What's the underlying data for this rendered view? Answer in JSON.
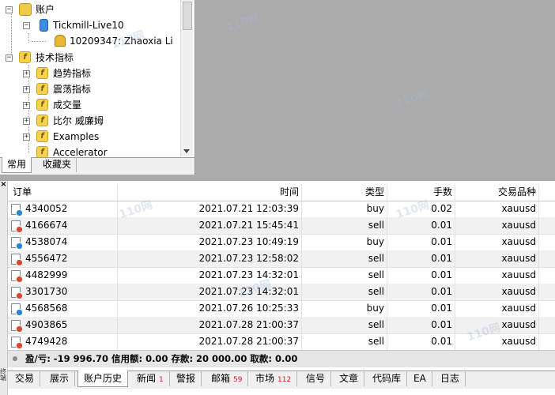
{
  "navigator": {
    "accounts_label": "账户",
    "server_label": "Tickmill-Live10",
    "account_label": "10209347: Zhaoxia Li",
    "indicators_label": "技术指标",
    "indicator_groups": [
      {
        "label": "趋势指标"
      },
      {
        "label": "震荡指标"
      },
      {
        "label": "成交量"
      },
      {
        "label": "比尔 威廉姆"
      },
      {
        "label": "Examples"
      },
      {
        "label": "Accelerator"
      }
    ],
    "tabs": [
      {
        "label": "常用"
      },
      {
        "label": "收藏夹"
      }
    ]
  },
  "terminal": {
    "close_glyph": "×",
    "side_label": "终端",
    "columns": {
      "order": "订单",
      "time": "时间",
      "type": "类型",
      "volume": "手数",
      "symbol": "交易品种"
    },
    "rows": [
      {
        "order": "4340052",
        "time": "2021.07.21 12:03:39",
        "type": "buy",
        "volume": "0.02",
        "symbol": "xauusd"
      },
      {
        "order": "4166674",
        "time": "2021.07.21 15:45:41",
        "type": "sell",
        "volume": "0.01",
        "symbol": "xauusd"
      },
      {
        "order": "4538074",
        "time": "2021.07.23 10:49:19",
        "type": "buy",
        "volume": "0.01",
        "symbol": "xauusd"
      },
      {
        "order": "4556472",
        "time": "2021.07.23 12:58:02",
        "type": "sell",
        "volume": "0.01",
        "symbol": "xauusd"
      },
      {
        "order": "4482999",
        "time": "2021.07.23 14:32:01",
        "type": "sell",
        "volume": "0.01",
        "symbol": "xauusd"
      },
      {
        "order": "3301730",
        "time": "2021.07.23 14:32:01",
        "type": "sell",
        "volume": "0.01",
        "symbol": "xauusd"
      },
      {
        "order": "4568568",
        "time": "2021.07.26 10:25:33",
        "type": "buy",
        "volume": "0.01",
        "symbol": "xauusd"
      },
      {
        "order": "4903865",
        "time": "2021.07.28 21:00:37",
        "type": "sell",
        "volume": "0.01",
        "symbol": "xauusd"
      },
      {
        "order": "4749428",
        "time": "2021.07.28 21:00:37",
        "type": "sell",
        "volume": "0.01",
        "symbol": "xauusd"
      }
    ],
    "summary": "盈/亏: -19 996.70  信用额: 0.00  存款: 20 000.00  取款: 0.00",
    "tabs": [
      {
        "label": "交易"
      },
      {
        "label": "展示"
      },
      {
        "label": "账户历史"
      },
      {
        "label": "新闻",
        "count": "1"
      },
      {
        "label": "警报"
      },
      {
        "label": "邮箱",
        "count": "59"
      },
      {
        "label": "市场",
        "count": "112"
      },
      {
        "label": "信号"
      },
      {
        "label": "文章"
      },
      {
        "label": "代码库"
      },
      {
        "label": "EA"
      },
      {
        "label": "日志"
      }
    ],
    "active_tab": "账户历史"
  },
  "colors": {
    "buy": "#2a84d6",
    "sell": "#e0462f",
    "folder": "#f2c94c"
  },
  "icons": {
    "accounts": "accounts-folder-icon",
    "server": "server-icon",
    "account": "user-icon",
    "indicators": "indicator-folder-icon",
    "indicator_group": "function-icon",
    "order_row": "order-document-icon"
  },
  "watermark": "110网"
}
